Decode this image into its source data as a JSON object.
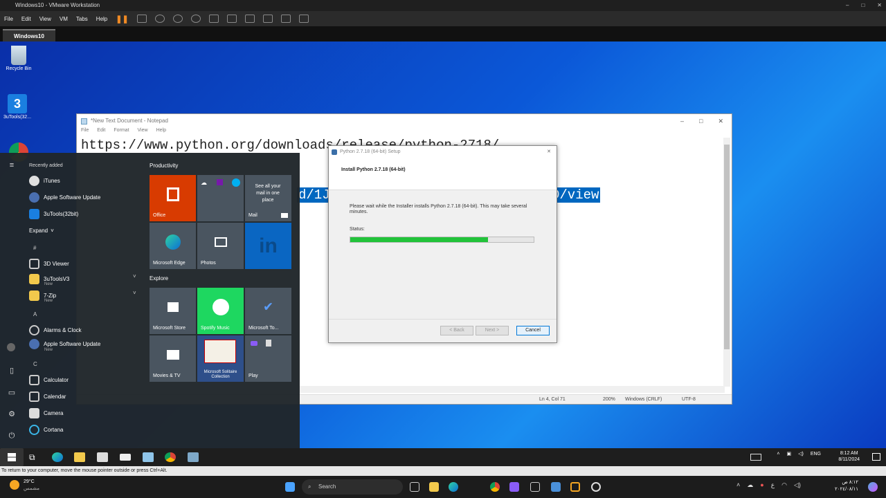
{
  "vm": {
    "title": "Windows10 - VMware Workstation",
    "menu": [
      "File",
      "Edit",
      "View",
      "VM",
      "Tabs",
      "Help"
    ],
    "tab": "Windows10",
    "status_hint": "To return to your computer, move the mouse pointer outside or press Ctrl+Alt."
  },
  "desktop": {
    "icons": [
      {
        "label": "Recycle Bin"
      },
      {
        "label": "3uTools(32..."
      }
    ]
  },
  "notepad": {
    "title": "*New Text Document - Notepad",
    "menu": [
      "File",
      "Edit",
      "Format",
      "View",
      "Help"
    ],
    "line1": "https://www.python.org/downloads/release/python-2718/",
    "highlight_left": "d/1J",
    "highlight_right": "D/view",
    "status": {
      "position": "Ln 4, Col 71",
      "zoom": "200%",
      "eol": "Windows (CRLF)",
      "encoding": "UTF-8"
    }
  },
  "setup": {
    "title": "Python 2.7.18 (64-bit) Setup",
    "heading": "Install Python 2.7.18 (64-bit)",
    "message": "Please wait while the Installer installs Python 2.7.18 (64-bit). This may take several minutes.",
    "status_label": "Status:",
    "progress": 0.75,
    "back": "< Back",
    "next": "Next >",
    "cancel": "Cancel"
  },
  "start_menu": {
    "recently_added": "Recently added",
    "recent": [
      "iTunes",
      "Apple Software Update",
      "3uTools(32bit)"
    ],
    "expand": "Expand",
    "apps": [
      {
        "letter": "#"
      },
      {
        "name": "3D Viewer"
      },
      {
        "name": "3uToolsV3",
        "sub": "New"
      },
      {
        "name": "7-Zip",
        "sub": "New"
      },
      {
        "letter": "A"
      },
      {
        "name": "Alarms & Clock"
      },
      {
        "name": "Apple Software Update",
        "sub": "New"
      },
      {
        "letter": "C"
      },
      {
        "name": "Calculator"
      },
      {
        "name": "Calendar"
      },
      {
        "name": "Camera"
      },
      {
        "name": "Cortana"
      }
    ],
    "groups": {
      "productivity": "Productivity",
      "explore": "Explore"
    },
    "tiles": {
      "office": "Office",
      "mail_text": "See all your mail in one place",
      "mail": "Mail",
      "edge": "Microsoft Edge",
      "photos": "Photos",
      "store": "Microsoft Store",
      "spotify": "Spotify Music",
      "todo": "Microsoft To...",
      "movies": "Movies & TV",
      "solitaire": "Microsoft Solitaire Collection",
      "play": "Play"
    }
  },
  "vm_taskbar": {
    "lang": "ENG",
    "time": "8:12 AM",
    "date": "8/11/2024"
  },
  "host_taskbar": {
    "temp": "29°C",
    "weather": "مشمس",
    "search": "Search",
    "time": "٨:١٢ ص",
    "date": "٢٠٢٤/٠٨/١١",
    "lang": "ع"
  }
}
